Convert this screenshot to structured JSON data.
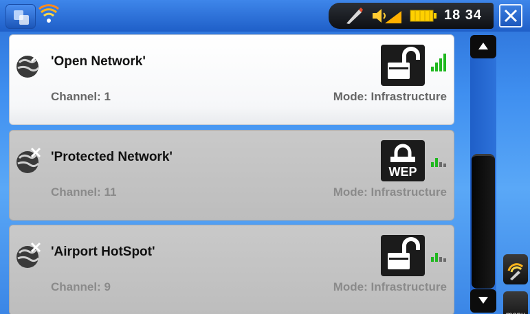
{
  "status": {
    "clock": "18 34"
  },
  "networks": [
    {
      "name": "'Open Network'",
      "channel": "Channel: 1",
      "mode": "Mode: Infrastructure",
      "security": "open",
      "signal_bars": 4,
      "selected": true
    },
    {
      "name": "'Protected Network'",
      "channel": "Channel: 11",
      "mode": "Mode: Infrastructure",
      "security": "WEP",
      "signal_bars": 2,
      "selected": false
    },
    {
      "name": "'Airport HotSpot'",
      "channel": "Channel: 9",
      "mode": "Mode: Infrastructure",
      "security": "open",
      "signal_bars": 2,
      "selected": false
    }
  ],
  "side": {
    "menu_label": "menu"
  },
  "colors": {
    "accent": "#2b6fd6",
    "signal_green": "#1fb81f"
  }
}
